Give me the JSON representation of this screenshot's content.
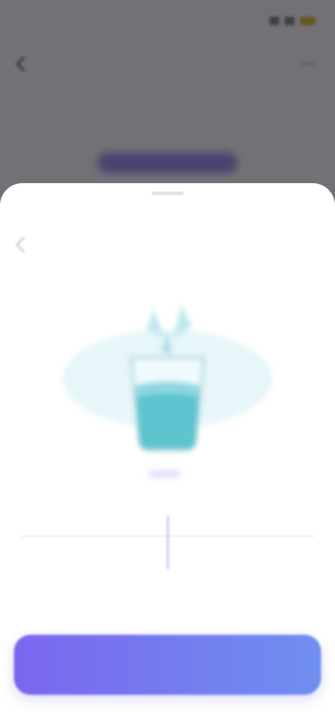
{
  "status_bar": {
    "time": "",
    "icons": [
      "signal-icon",
      "wifi-icon",
      "battery-icon"
    ]
  },
  "background_page": {
    "title": "",
    "back_icon": "chevron-left-icon",
    "more_icon": "more-icon"
  },
  "sheet": {
    "title": "",
    "back_icon": "chevron-left-icon",
    "illustration": "water-glass-icon",
    "amount": {
      "value": "",
      "unit": ""
    },
    "ruler": {
      "labels": [
        "",
        "",
        "",
        "",
        ""
      ]
    },
    "primary_button": {
      "label": ""
    }
  },
  "colors": {
    "accent": "#7b66ef",
    "accent_secondary": "#6f8ff0",
    "water": "#5ec4d0",
    "sheet_background": "#ffffff",
    "overlay": "#4a4a4e"
  }
}
